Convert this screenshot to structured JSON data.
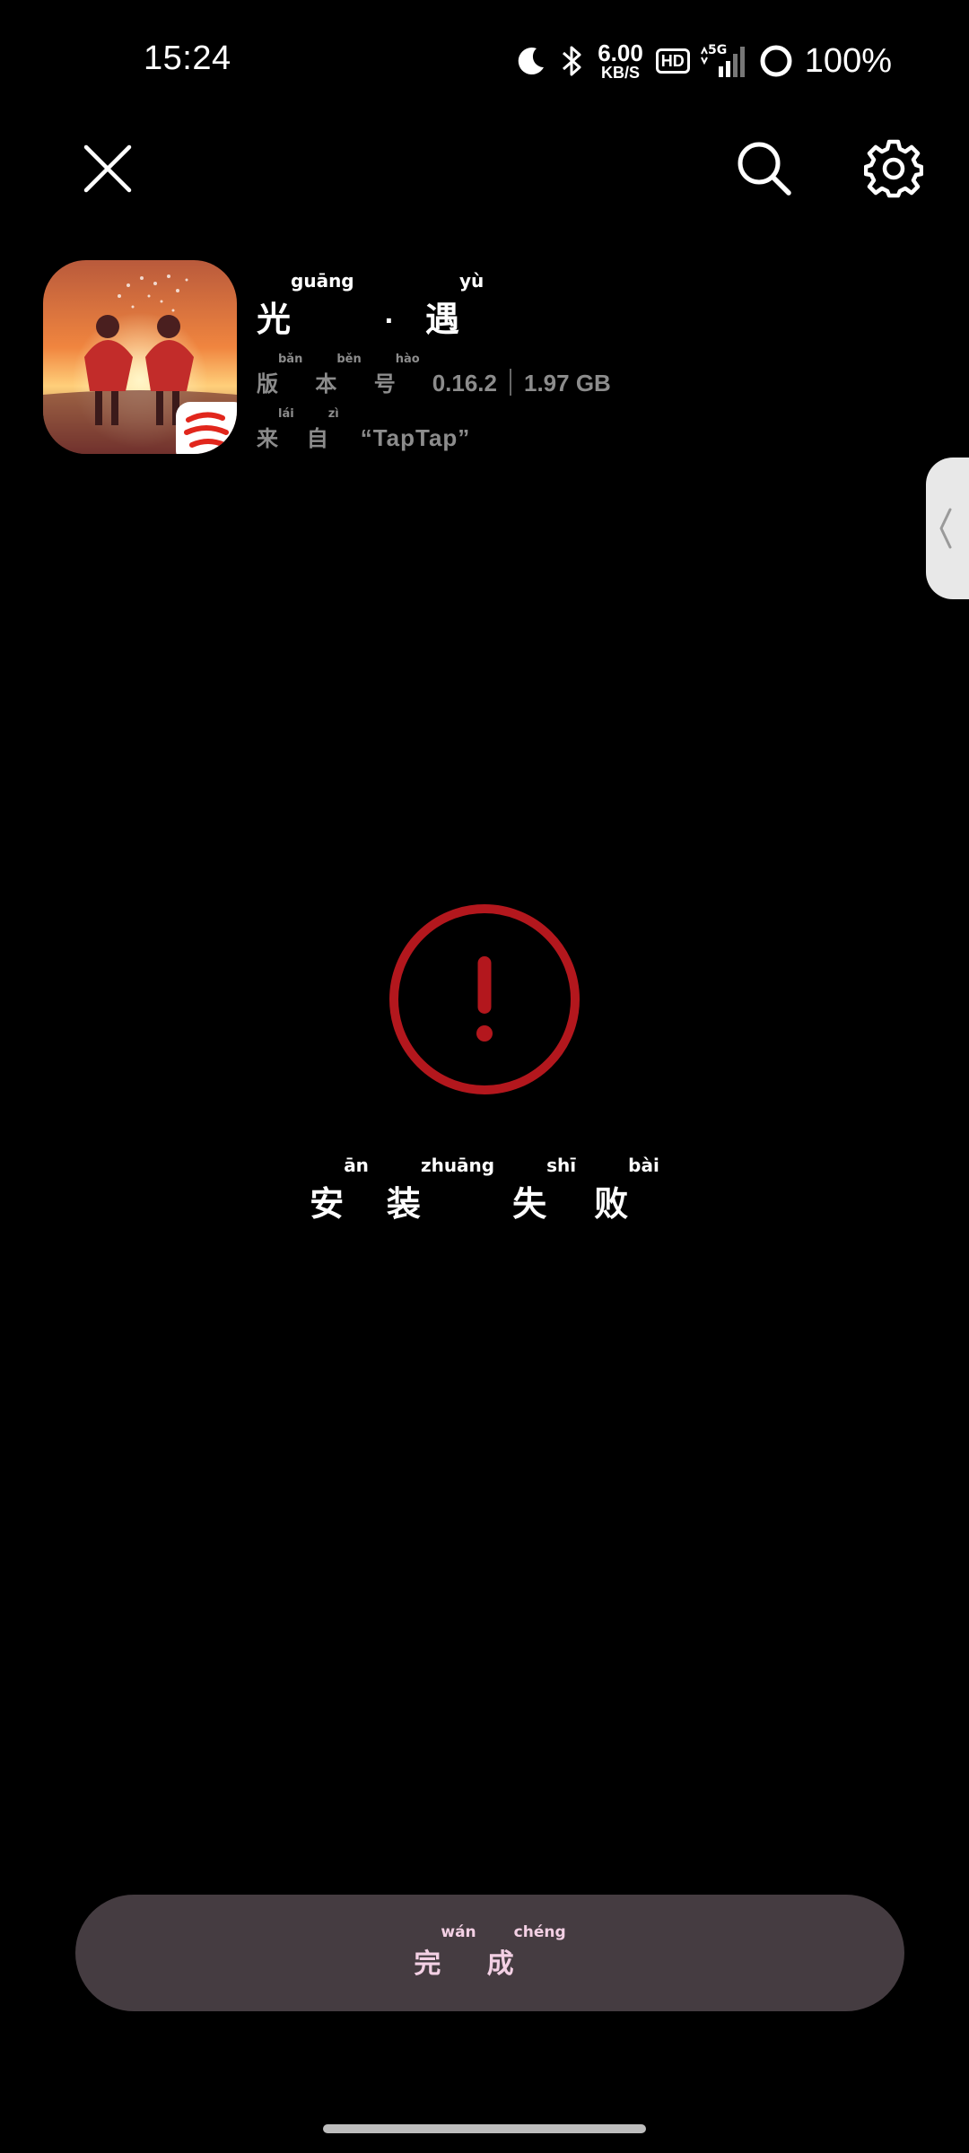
{
  "status_bar": {
    "time": "15:24",
    "net_speed_value": "6.00",
    "net_speed_unit": "KB/S",
    "hd_label": "HD",
    "network_label": "5G",
    "battery_percent": "100%",
    "icons": [
      "moon-icon",
      "bluetooth-icon",
      "signal-icon",
      "battery-icon"
    ]
  },
  "toolbar": {
    "close_icon": "close-icon",
    "search_icon": "search-icon",
    "settings_icon": "gear-icon"
  },
  "app": {
    "name_chars": [
      {
        "char": "光",
        "pinyin": "guāng"
      },
      {
        "char": "遇",
        "pinyin": "yù"
      }
    ],
    "name_separator": "·",
    "version_label": [
      {
        "char": "版",
        "pinyin": "bǎn"
      },
      {
        "char": "本",
        "pinyin": "běn"
      },
      {
        "char": "号",
        "pinyin": "hào"
      }
    ],
    "version": "0.16.2",
    "size": "1.97 GB",
    "source_label": [
      {
        "char": "来",
        "pinyin": "lái"
      },
      {
        "char": "自",
        "pinyin": "zì"
      }
    ],
    "source": "“TapTap”"
  },
  "result": {
    "status_icon": "exclamation-circle-icon",
    "accent_color": "#b3171d",
    "message": [
      {
        "char": "安",
        "pinyin": "ān"
      },
      {
        "char": "装",
        "pinyin": "zhuāng"
      },
      {
        "char": "失",
        "pinyin": "shī"
      },
      {
        "char": "败",
        "pinyin": "bài"
      }
    ]
  },
  "done_button": {
    "label": [
      {
        "char": "完",
        "pinyin": "wán"
      },
      {
        "char": "成",
        "pinyin": "chéng"
      }
    ],
    "background": "#453c41",
    "text_color": "#f3d0e4"
  }
}
